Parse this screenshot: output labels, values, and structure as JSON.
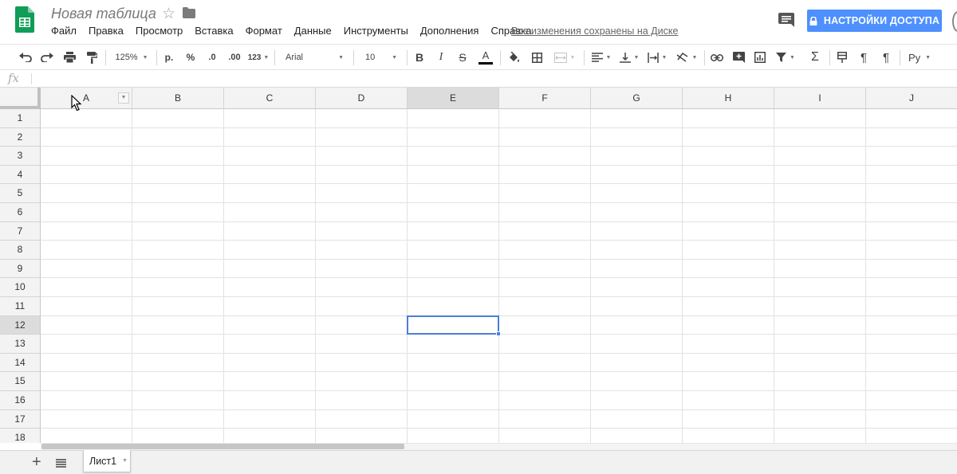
{
  "app": {
    "doc_title": "Новая таблица",
    "save_status": "Все изменения сохранены на Диске",
    "share_label": "НАСТРОЙКИ ДОСТУПА"
  },
  "menu": [
    "Файл",
    "Правка",
    "Просмотр",
    "Вставка",
    "Формат",
    "Данные",
    "Инструменты",
    "Дополнения",
    "Справка"
  ],
  "toolbar": {
    "zoom": "125%",
    "currency": "р.",
    "percent": "%",
    "decrease_decimal": ".0",
    "increase_decimal": ".00",
    "more_formats": "123",
    "font": "Arial",
    "font_size": "10",
    "bold": "B",
    "italic": "I",
    "strike": "S",
    "text_color": "A",
    "input_tools": "Ру",
    "text_color_value": "#000000"
  },
  "formula_bar": {
    "fx": "fx",
    "value": ""
  },
  "grid": {
    "columns": [
      "A",
      "B",
      "C",
      "D",
      "E",
      "F",
      "G",
      "H",
      "I",
      "J"
    ],
    "rows": [
      "1",
      "2",
      "3",
      "4",
      "5",
      "6",
      "7",
      "8",
      "9",
      "10",
      "11",
      "12",
      "13",
      "14",
      "15",
      "16",
      "17",
      "18"
    ],
    "selected_column": "E",
    "selected_row": "12"
  },
  "sheets": {
    "add": "+",
    "tabs": [
      "Лист1"
    ]
  },
  "colors": {
    "accent": "#4d90fe",
    "selection": "#4a7fd6",
    "logo_green": "#0f9d58"
  }
}
